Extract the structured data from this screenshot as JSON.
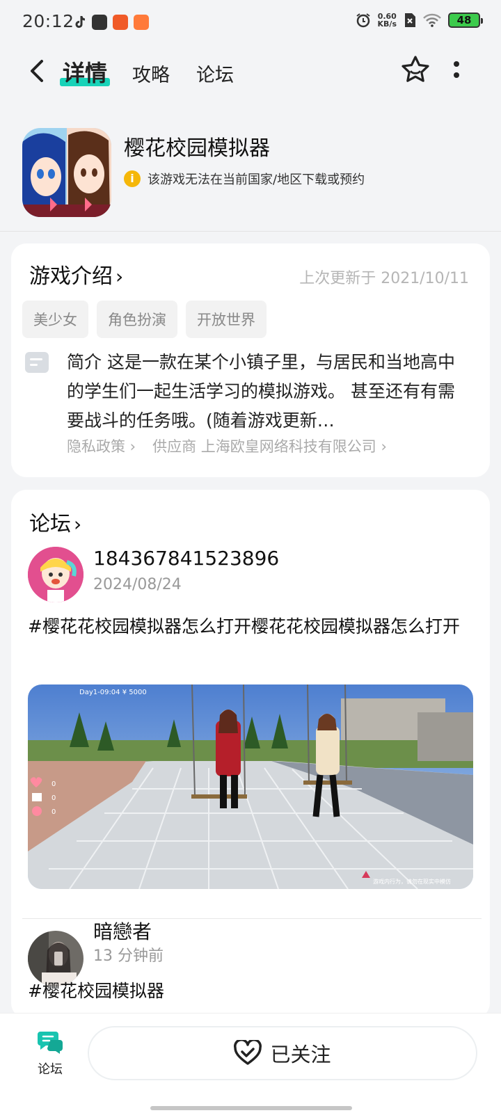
{
  "status_bar": {
    "time": "20:12",
    "speed_value": "0.60",
    "speed_unit": "KB/s",
    "battery": "48"
  },
  "nav": {
    "tabs": [
      {
        "label": "详情"
      },
      {
        "label": "攻略"
      },
      {
        "label": "论坛"
      }
    ]
  },
  "app": {
    "name": "樱花校园模拟器",
    "notice": "该游戏无法在当前国家/地区下载或预约"
  },
  "intro": {
    "title": "游戏介绍",
    "updated": "上次更新于 2021/10/11",
    "tags": [
      "美少女",
      "角色扮演",
      "开放世界"
    ],
    "description": "简介 这是一款在某个小镇子里，与居民和当地高中的学生们一起生活学习的模拟游戏。 甚至还有有需要战斗的任务哦。(随着游戏更新…",
    "privacy_link": "隐私政策",
    "supplier_link": "供应商 上海欧皇网络科技有限公司"
  },
  "forum": {
    "title": "论坛",
    "posts": [
      {
        "user": "184367841523896",
        "date": "2024/08/24",
        "text": "#樱花花校园模拟器怎么打开樱花花校园模拟器怎么打开",
        "image_overlay_text": "Day1-09:04 ¥ 5000",
        "image_counts": [
          "0",
          "0",
          "0"
        ],
        "image_footer": "游戏内行为，请勿在现实中模仿"
      },
      {
        "user": "暗戀者",
        "date": "13 分钟前",
        "text": "#樱花校园模拟器"
      }
    ]
  },
  "bottom": {
    "forum_tab_label": "论坛",
    "follow_label": "已关注"
  },
  "colors": {
    "accent": "#18d2b8",
    "info": "#f5b70a",
    "battery": "#3ccb4c"
  }
}
